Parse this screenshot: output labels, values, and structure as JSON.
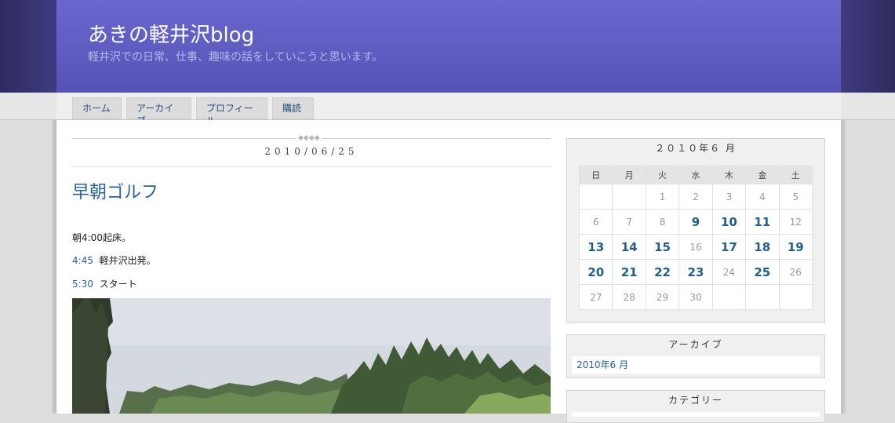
{
  "header": {
    "title": "あきの軽井沢blog",
    "description": "軽井沢での日常、仕事、趣味の話をしていこうと思います。"
  },
  "nav": {
    "tabs": [
      "ホーム",
      "アーカイブ",
      "プロフィール",
      "購読"
    ]
  },
  "post": {
    "date_ornament": "◆◆◆◆",
    "date": "2010/06/25",
    "title": "早朝ゴルフ",
    "lines": [
      {
        "time": "朝4:00",
        "text": "起床。"
      },
      {
        "time": "4:45",
        "text": "軽井沢出発。"
      },
      {
        "time": "5:30",
        "text": "スタート"
      }
    ]
  },
  "calendar": {
    "title": "２０１０年６ 月",
    "weekdays": [
      "日",
      "月",
      "火",
      "水",
      "木",
      "金",
      "土"
    ],
    "weeks": [
      [
        "",
        "",
        "1",
        "2",
        "3",
        "4",
        "5"
      ],
      [
        "6",
        "7",
        "8",
        "9",
        "10",
        "11",
        "12"
      ],
      [
        "13",
        "14",
        "15",
        "16",
        "17",
        "18",
        "19"
      ],
      [
        "20",
        "21",
        "22",
        "23",
        "24",
        "25",
        "26"
      ],
      [
        "27",
        "28",
        "29",
        "30",
        "",
        "",
        ""
      ]
    ],
    "linked_days": [
      "9",
      "10",
      "11",
      "13",
      "14",
      "15",
      "17",
      "18",
      "19",
      "20",
      "21",
      "22",
      "23",
      "25"
    ]
  },
  "archive": {
    "title": "アーカイブ",
    "items": [
      "2010年6 月"
    ]
  },
  "category": {
    "title": "カテゴリー"
  },
  "colors": {
    "header": "#6666cc",
    "link": "#1f5f8f"
  }
}
